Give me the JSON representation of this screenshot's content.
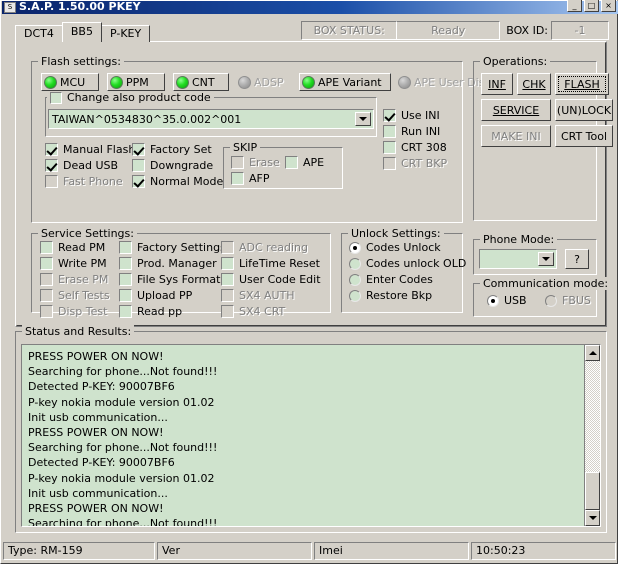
{
  "window": {
    "title": "S.A.P. 1.50.00 PKEY",
    "icon": "app-icon",
    "minimize": "_",
    "maximize": "□",
    "close": "×"
  },
  "tabs": [
    {
      "label": "DCT4",
      "selected": false
    },
    {
      "label": "BB5",
      "selected": true
    },
    {
      "label": "P-KEY",
      "selected": false
    }
  ],
  "box": {
    "status_label": "BOX STATUS:",
    "status_value": "Ready",
    "id_label": "BOX ID:",
    "id_value": "-1"
  },
  "flash_settings": {
    "legend": "Flash settings:",
    "led_buttons": [
      {
        "label": "MCU",
        "on": true,
        "enabled": true,
        "underline": "M"
      },
      {
        "label": "PPM",
        "on": true,
        "enabled": true,
        "underline": "P"
      },
      {
        "label": "CNT",
        "on": true,
        "enabled": true,
        "underline": "C"
      },
      {
        "label": "ADSP",
        "on": false,
        "enabled": false,
        "underline": "A"
      },
      {
        "label": "APE Variant",
        "on": true,
        "enabled": true,
        "underline": "V"
      },
      {
        "label": "APE User Disk",
        "on": false,
        "enabled": false,
        "underline": "D"
      }
    ],
    "product_code": {
      "checkbox_label": "Change also product code",
      "checked": false,
      "value": "TAIWAN^0534830^35.0.002^001"
    },
    "left_checks": [
      {
        "label": "Manual Flash",
        "checked": true,
        "enabled": true
      },
      {
        "label": "Dead USB",
        "checked": true,
        "enabled": true
      },
      {
        "label": "Fast Phone",
        "checked": false,
        "enabled": false
      }
    ],
    "mid_checks": [
      {
        "label": "Factory Set",
        "checked": true,
        "enabled": true
      },
      {
        "label": "Downgrade",
        "checked": false,
        "enabled": true
      },
      {
        "label": "Normal Mode",
        "checked": true,
        "enabled": true
      }
    ],
    "skip": {
      "legend": "SKIP",
      "items": [
        {
          "label": "Erase",
          "checked": false,
          "enabled": false
        },
        {
          "label": "APE",
          "checked": false,
          "enabled": true
        },
        {
          "label": "AFP",
          "checked": false,
          "enabled": true
        }
      ]
    },
    "ini_checks": [
      {
        "label": "Use INI",
        "checked": true,
        "enabled": true
      },
      {
        "label": "Run INI",
        "checked": false,
        "enabled": true
      },
      {
        "label": "CRT 308",
        "checked": false,
        "enabled": true
      },
      {
        "label": "CRT BKP",
        "checked": false,
        "enabled": false
      }
    ]
  },
  "service_settings": {
    "legend": "Service Settings:",
    "col1": [
      {
        "label": "Read PM",
        "checked": false,
        "enabled": true
      },
      {
        "label": "Write PM",
        "checked": false,
        "enabled": true
      },
      {
        "label": "Erase PM",
        "checked": false,
        "enabled": false
      },
      {
        "label": "Self Tests",
        "checked": false,
        "enabled": false
      },
      {
        "label": "Disp Test",
        "checked": false,
        "enabled": false
      }
    ],
    "col2": [
      {
        "label": "Factory Settings",
        "checked": false,
        "enabled": true
      },
      {
        "label": "Prod. Manager",
        "checked": false,
        "enabled": true
      },
      {
        "label": "File Sys Format",
        "checked": false,
        "enabled": true
      },
      {
        "label": "Upload PP",
        "checked": false,
        "enabled": true
      },
      {
        "label": "Read pp",
        "checked": false,
        "enabled": true
      }
    ],
    "col3": [
      {
        "label": "ADC reading",
        "checked": false,
        "enabled": false
      },
      {
        "label": "LifeTime Reset",
        "checked": false,
        "enabled": true
      },
      {
        "label": "User Code Edit",
        "checked": false,
        "enabled": true
      },
      {
        "label": "SX4 AUTH",
        "checked": false,
        "enabled": false
      },
      {
        "label": "SX4 CRT",
        "checked": false,
        "enabled": false
      }
    ]
  },
  "unlock_settings": {
    "legend": "Unlock Settings:",
    "options": [
      {
        "label": "Codes Unlock",
        "selected": true
      },
      {
        "label": "Codes unlock OLD",
        "selected": false
      },
      {
        "label": "Enter Codes",
        "selected": false
      },
      {
        "label": "Restore Bkp",
        "selected": false
      }
    ]
  },
  "operations": {
    "legend": "Operations:",
    "buttons": [
      {
        "label": "INF",
        "enabled": true,
        "focus": false
      },
      {
        "label": "CHK",
        "enabled": true,
        "focus": false
      },
      {
        "label": "FLASH",
        "enabled": true,
        "focus": true
      },
      {
        "label": "SERVICE",
        "enabled": true,
        "focus": false
      },
      {
        "label": "(UN)LOCK",
        "enabled": true,
        "focus": false
      },
      {
        "label": "MAKE INI",
        "enabled": false,
        "focus": false
      },
      {
        "label": "CRT Tool",
        "enabled": true,
        "focus": false
      }
    ]
  },
  "phone_mode": {
    "legend": "Phone Mode:",
    "value": "",
    "help_label": "?"
  },
  "communication_mode": {
    "legend": "Communication mode:",
    "options": [
      {
        "label": "USB",
        "selected": true,
        "enabled": true
      },
      {
        "label": "FBUS",
        "selected": false,
        "enabled": false
      }
    ]
  },
  "status_results": {
    "legend": "Status and Results:",
    "lines": [
      "PRESS POWER ON NOW!",
      "Searching for phone...Not found!!!",
      "Detected P-KEY: 90007BF6",
      "P-key nokia module version 01.02",
      "Init usb communication...",
      "PRESS POWER ON NOW!",
      "Searching for phone...Not found!!!",
      "Detected P-KEY: 90007BF6",
      "P-key nokia module version 01.02",
      "Init usb communication...",
      "PRESS POWER ON NOW!",
      "Searching for phone...Not found!!!"
    ]
  },
  "statusbar": {
    "type": "Type: RM-159",
    "ver": "Ver",
    "imei": "Imei",
    "time": "10:50:23"
  },
  "colors": {
    "face": "#d4d0c8",
    "field_green": "#cfe3cd",
    "led_on": "#22dd22",
    "title_start": "#0a246a"
  }
}
